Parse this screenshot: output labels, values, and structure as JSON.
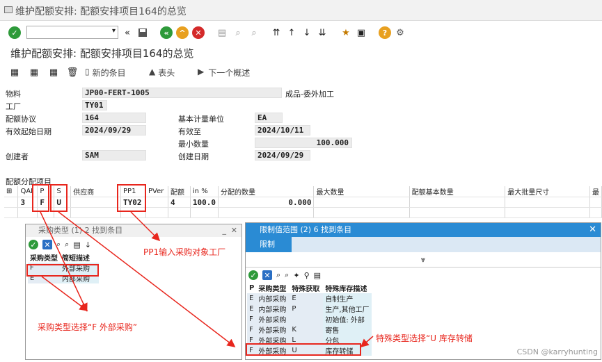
{
  "window_title": "维护配额安排: 配额安排项目164的总览",
  "subtitle": "维护配额安排: 配额安排项目164的总览",
  "toolbar": {
    "command_value": ""
  },
  "apptoolbar": {
    "new_entry": "新的条目",
    "header": "表头",
    "next_overview": "下一个概述"
  },
  "header": {
    "material_label": "物料",
    "material_value": "JP00-FERT-1005",
    "material_desc": "成品-委外加工",
    "plant_label": "工厂",
    "plant_value": "TY01",
    "qa_label": "配额协议",
    "qa_value": "164",
    "uom_label": "基本计量单位",
    "uom_value": "EA",
    "valid_from_label": "有效起始日期",
    "valid_from_value": "2024/09/29",
    "valid_to_label": "有效至",
    "valid_to_value": "2024/10/11",
    "min_qty_label": "最小数量",
    "min_qty_value": "100.000",
    "created_by_label": "创建者",
    "created_by_value": "SAM",
    "created_on_label": "创建日期",
    "created_on_value": "2024/09/29"
  },
  "items_section_label": "配额分配项目",
  "grid": {
    "headers": [
      "QAI",
      "P",
      "S",
      "供应商",
      "PP1",
      "PVer",
      "配额",
      "in %",
      "分配的数量",
      "最大数量",
      "配额基本数量",
      "最大批量尺寸",
      "最"
    ],
    "row": [
      "3",
      "F",
      "U",
      "",
      "TY02",
      "",
      "4",
      "100.0",
      "0.000",
      "",
      "",
      "",
      ""
    ]
  },
  "popup1": {
    "title": "采购类型 (1)   2 找到条目",
    "col1": "采购类型",
    "col2": "简短描述",
    "rows": [
      {
        "k": "F",
        "v": "外部采购"
      },
      {
        "k": "E",
        "v": "内部采购"
      }
    ]
  },
  "popup2": {
    "title": "限制值范围 (2)   6 找到条目",
    "tab": "限制",
    "headers": [
      "P",
      "采购类型",
      "特殊获取",
      "特殊库存描述"
    ],
    "rows": [
      {
        "p": "E",
        "t": "内部采购",
        "s": "E",
        "d": "自制生产"
      },
      {
        "p": "E",
        "t": "内部采购",
        "s": "P",
        "d": "生产,其他工厂"
      },
      {
        "p": "F",
        "t": "外部采购",
        "s": "",
        "d": "初始值: 外部"
      },
      {
        "p": "F",
        "t": "外部采购",
        "s": "K",
        "d": "寄售"
      },
      {
        "p": "F",
        "t": "外部采购",
        "s": "L",
        "d": "分包"
      },
      {
        "p": "F",
        "t": "外部采购",
        "s": "U",
        "d": "库存转储"
      }
    ]
  },
  "annotations": {
    "pp1": "PP1输入采购对象工厂",
    "proc_type": "采购类型选择“F 外部采购”",
    "special": "特殊类型选择“U 库存转储"
  },
  "watermark": "CSDN @karryhunting",
  "colors": {
    "accent": "#2a8bd4",
    "annotation": "#e8261d",
    "field_bg": "#ececec"
  }
}
